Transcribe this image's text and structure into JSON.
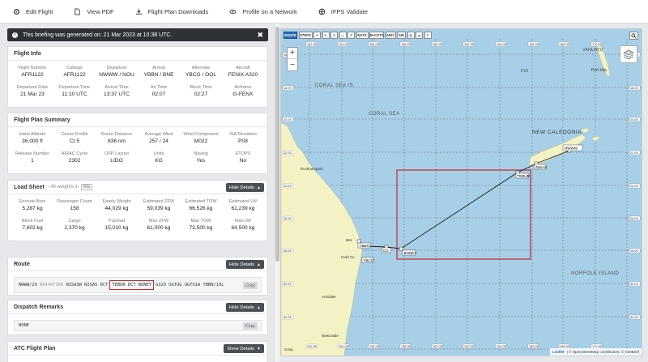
{
  "toolbar": [
    {
      "label": "Edit Flight",
      "icon": "gear-icon"
    },
    {
      "label": "View PDF",
      "icon": "document-icon"
    },
    {
      "label": "Flight Plan Downloads",
      "icon": "download-icon"
    },
    {
      "label": "Profile on a Network",
      "icon": "eye-icon"
    },
    {
      "label": "IFPS Validate",
      "icon": "globe-icon"
    }
  ],
  "alert": {
    "text": "This briefing was generated on: 21 Mar 2023 at 10:38 UTC.",
    "close": "✖"
  },
  "flight_info": {
    "title": "Flight Info",
    "row1": [
      {
        "label": "Flight Number",
        "value": "AFR1122"
      },
      {
        "label": "Callsign",
        "value": "AFR1122"
      },
      {
        "label": "Departure",
        "value": "NWWW / NOU"
      },
      {
        "label": "Arrival",
        "value": "YBBN / BNE"
      },
      {
        "label": "Alternate",
        "value": "YBCG / OOL"
      },
      {
        "label": "Aircraft",
        "value": "FENIX A320"
      }
    ],
    "row2": [
      {
        "label": "Departure Date",
        "value": "21 Mar 23"
      },
      {
        "label": "Departure Time",
        "value": "11:10 UTC"
      },
      {
        "label": "Arrival Time",
        "value": "13:37 UTC"
      },
      {
        "label": "Air Time",
        "value": "02:07"
      },
      {
        "label": "Block Time",
        "value": "02:27"
      },
      {
        "label": "Airframe",
        "value": "G-FENX"
      }
    ]
  },
  "flight_plan_summary": {
    "title": "Flight Plan Summary",
    "row1": [
      {
        "label": "Initial Altitude",
        "value": "36,000 ft"
      },
      {
        "label": "Cruise Profile",
        "value": "CI 5"
      },
      {
        "label": "Route Distance",
        "value": "836 nm"
      },
      {
        "label": "Average Wind",
        "value": "257 / 24"
      },
      {
        "label": "Wind Component",
        "value": "M022"
      },
      {
        "label": "ISA Deviation",
        "value": "P08"
      }
    ],
    "row2": [
      {
        "label": "Release Number",
        "value": "1"
      },
      {
        "label": "AIRAC Cycle",
        "value": "2302"
      },
      {
        "label": "OFP Layout",
        "value": "LIDO"
      },
      {
        "label": "Units",
        "value": "KG"
      },
      {
        "label": "Navlog",
        "value": "Yes"
      },
      {
        "label": "ETOPS",
        "value": "No"
      }
    ]
  },
  "load_sheet": {
    "title": "Load Sheet",
    "subtitle": "- All weights in",
    "unit_badge": "KG",
    "button": "Hide Details",
    "row1": [
      {
        "label": "Enroute Burn",
        "value": "5,287 kg"
      },
      {
        "label": "Passenger Count",
        "value": "158"
      },
      {
        "label": "Empty Weight",
        "value": "44,029 kg"
      },
      {
        "label": "Estimated ZFW",
        "value": "59,039 kg"
      },
      {
        "label": "Estimated TOW",
        "value": "66,526 kg"
      },
      {
        "label": "Estimated LW",
        "value": "61,239 kg"
      }
    ],
    "row2": [
      {
        "label": "Block Fuel",
        "value": "7,602 kg"
      },
      {
        "label": "Cargo",
        "value": "2,370 kg"
      },
      {
        "label": "Payload",
        "value": "15,010 kg"
      },
      {
        "label": "Max ZFW",
        "value": "61,000 kg"
      },
      {
        "label": "Max TOW",
        "value": "73,500 kg"
      },
      {
        "label": "Max LW",
        "value": "64,500 kg"
      }
    ]
  },
  "route": {
    "title": "Route",
    "button": "Hide Details",
    "origin": "NWWW/29",
    "grey": "N0446F360",
    "pre": "NISA3W NISA5 DCT",
    "highlight": "TEBUR DCT BONEY",
    "post": "G329 UGTUG UGTU1A YBBN/19L",
    "copy": "Copy"
  },
  "dispatch": {
    "title": "Dispatch Remarks",
    "button": "Hide Details",
    "text": "NONE",
    "copy": "Copy"
  },
  "atc": {
    "title": "ATC Flight Plan",
    "button": "Show Details"
  },
  "map": {
    "tools": [
      "ROUTE",
      "STEPS"
    ],
    "tools_wide": [
      "NATS",
      "PACOTS",
      "AIRS",
      "SID"
    ],
    "labels": {
      "coral_sea_is": "CORAL SEA IS.",
      "coral_sea": "CORAL SEA",
      "new_caledonia": "NEW CALEDONIA",
      "norfolk": "NORFOLK ISLAND",
      "fiji": "FIJI",
      "vanuatu": "VANUATU",
      "port_vila": "Port Vila",
      "rockhampton": "Rockhampton",
      "armidale": "Armidale",
      "newcastle": "Newcastle",
      "brisbane": "Bris",
      "gold_coast": "Gold Co",
      "gosp": "Gosp"
    },
    "waypoints": {
      "nwww": "NWWW",
      "nisas": "NISAS",
      "tebur": "TEBUR",
      "boney": "BONEY",
      "ybbn": "YBBN",
      "ybcg": "YBCG",
      "g3": "G3"
    },
    "top_ticks": [
      "152.0E",
      "154.0E",
      "156.0E",
      "158.0E",
      "160.0E",
      "162.0E",
      "164.0E",
      "166.0E",
      "168.0E",
      "170.0E"
    ],
    "bottom_ticks": [
      "152.0E",
      "154.0E",
      "156.0E",
      "158.0E",
      "160.0E",
      "162.0E",
      "164.0E",
      "166.0E",
      "168.0E",
      "170.0E"
    ],
    "lat_ticks": [
      "16.0S",
      "18.0S",
      "20.0S",
      "22.0S",
      "24.0S",
      "26.0S",
      "28.0S",
      "30.0S",
      "32.0S",
      "34.0S"
    ],
    "attribution_brand": "Leaflet",
    "attribution": "| © OpenStreetMap contributors, © SimBrief",
    "colors": {
      "sea": "#a7cfe8",
      "land": "#f4f2c4",
      "route": "#1a1a1a",
      "highlight_box": "#c8262b"
    }
  }
}
